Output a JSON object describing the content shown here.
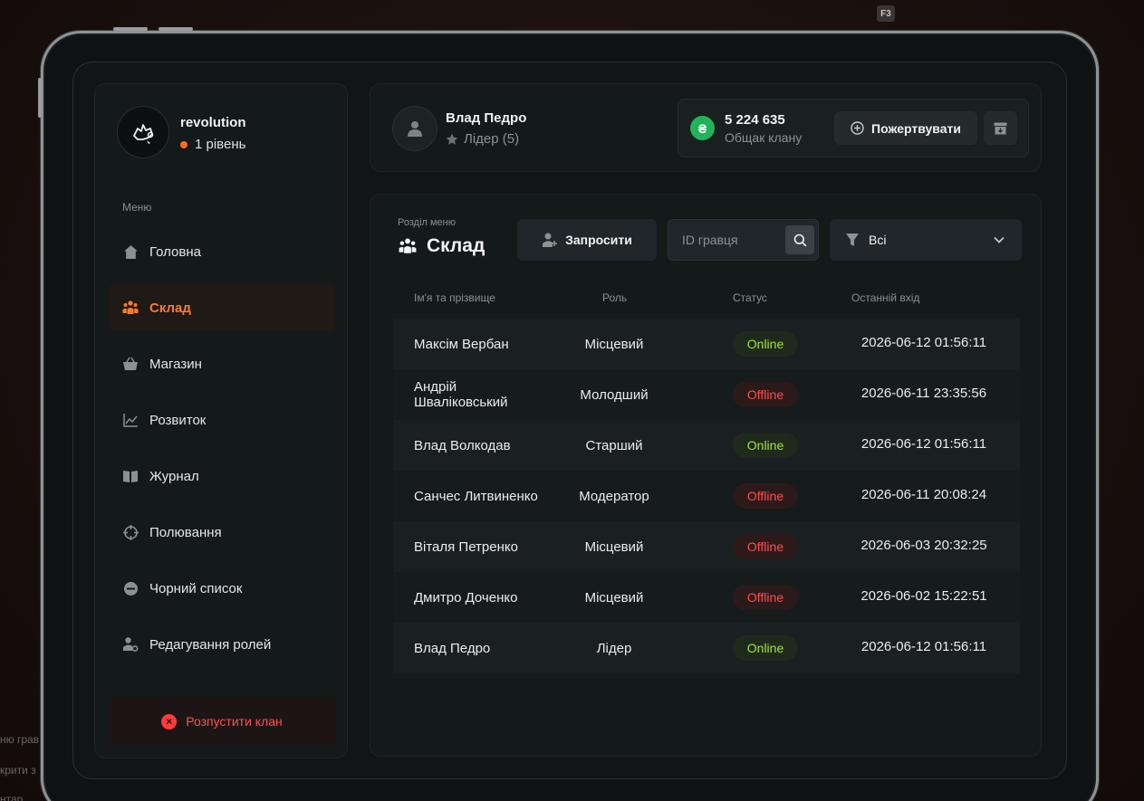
{
  "background": {
    "key_hint": "F3",
    "side_texts": [
      "ню грав",
      "крити з",
      "нтар"
    ]
  },
  "clan": {
    "name": "revolution",
    "level": "1 рівень"
  },
  "sidebar": {
    "menu_title": "Меню",
    "items": [
      {
        "label": "Головна",
        "icon": "home-icon"
      },
      {
        "label": "Склад",
        "icon": "users-icon",
        "active": true
      },
      {
        "label": "Магазин",
        "icon": "basket-icon"
      },
      {
        "label": "Розвиток",
        "icon": "chart-icon"
      },
      {
        "label": "Журнал",
        "icon": "book-icon"
      },
      {
        "label": "Полювання",
        "icon": "crosshair-icon"
      },
      {
        "label": "Чорний список",
        "icon": "block-icon"
      },
      {
        "label": "Редагування ролей",
        "icon": "user-gear-icon"
      }
    ],
    "disband_label": "Розпустити клан"
  },
  "header": {
    "player_name": "Влад Педро",
    "player_role": "Лідер (5)",
    "bank_currency": "₴",
    "bank_amount": "5 224 635",
    "bank_label": "Общак клану",
    "donate_label": "Пожертвувати"
  },
  "content": {
    "section_label": "Розділ меню",
    "section_title": "Склад",
    "invite_label": "Запросити",
    "search_placeholder": "ID гравця",
    "filter_value": "Всі",
    "columns": [
      "Ім'я та прізвище",
      "Роль",
      "Статус",
      "Останній вхід"
    ],
    "members": [
      {
        "name": "Максім Вербан",
        "role": "Місцевий",
        "status": "Online",
        "last": "2026-06-12 01:56:11"
      },
      {
        "name": "Андрій Шваліковський",
        "role": "Молодший",
        "status": "Offline",
        "last": "2026-06-11 23:35:56"
      },
      {
        "name": "Влад Волкодав",
        "role": "Старший",
        "status": "Online",
        "last": "2026-06-12 01:56:11"
      },
      {
        "name": "Санчес Литвиненко",
        "role": "Модератор",
        "status": "Offline",
        "last": "2026-06-11 20:08:24"
      },
      {
        "name": "Віталя Петренко",
        "role": "Місцевий",
        "status": "Offline",
        "last": "2026-06-03 20:32:25"
      },
      {
        "name": "Дмитро Доченко",
        "role": "Місцевий",
        "status": "Offline",
        "last": "2026-06-02 15:22:51"
      },
      {
        "name": "Влад Педро",
        "role": "Лідер",
        "status": "Online",
        "last": "2026-06-12 01:56:11"
      }
    ]
  },
  "colors": {
    "accent": "#ff7a2e",
    "online": "#a6e23c",
    "offline": "#ff4d4d",
    "coin": "#22b35a",
    "danger": "#ff3b3b"
  }
}
